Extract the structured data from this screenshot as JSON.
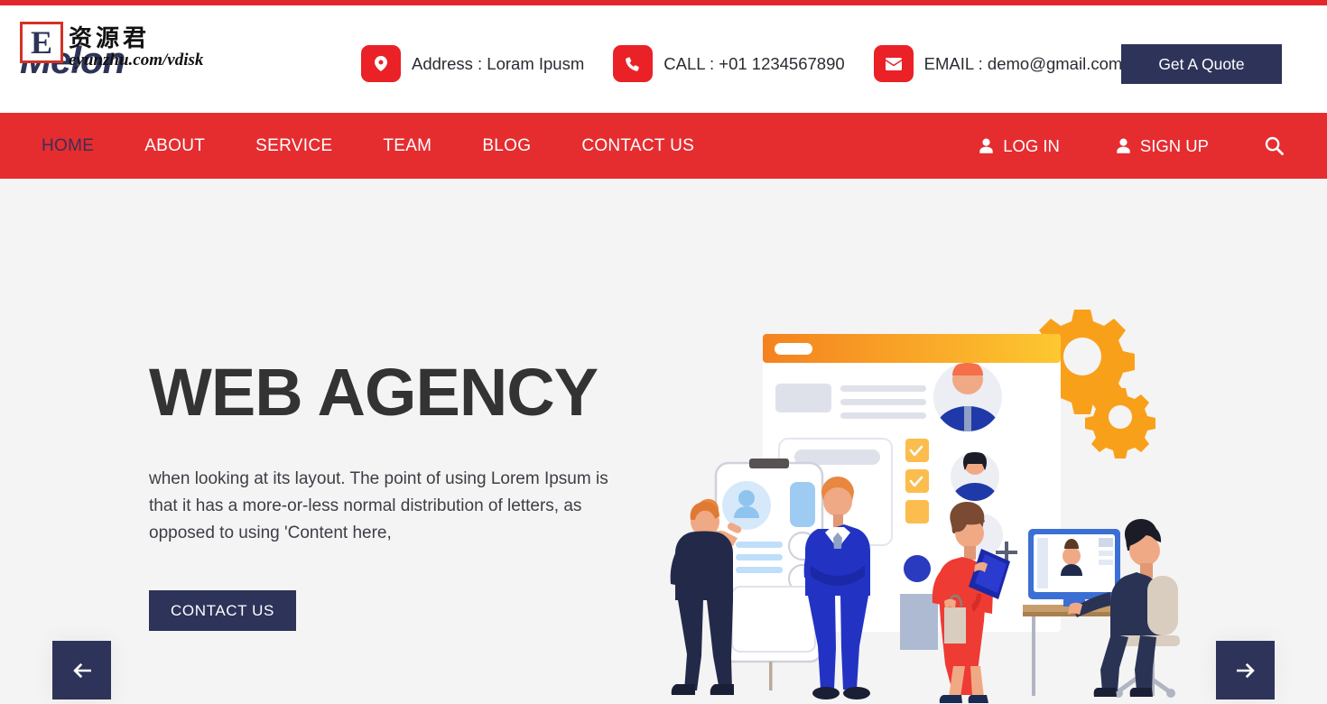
{
  "colors": {
    "primary_red": "#e52d30",
    "icon_red": "#ea2127",
    "navy": "#2e3359",
    "hero_bg": "#f4f4f4",
    "title_gray": "#333333",
    "accent_orange": "#f5a623",
    "accent_yellow": "#fdb913"
  },
  "topbar": {
    "logo_text": "Melon",
    "watermark": {
      "letter": "E",
      "chinese": "资源君",
      "url": "eyunzhu.com/vdisk"
    },
    "contacts": [
      {
        "icon": "location-pin-icon",
        "label": "Address : Loram Ipusm"
      },
      {
        "icon": "phone-icon",
        "label": "CALL : +01 1234567890"
      },
      {
        "icon": "envelope-icon",
        "label": "EMAIL : demo@gmail.com"
      }
    ],
    "quote_button": "Get A Quote"
  },
  "nav": {
    "items": [
      {
        "label": "HOME",
        "active": true
      },
      {
        "label": "ABOUT",
        "active": false
      },
      {
        "label": "SERVICE",
        "active": false
      },
      {
        "label": "TEAM",
        "active": false
      },
      {
        "label": "BLOG",
        "active": false
      },
      {
        "label": "CONTACT US",
        "active": false
      }
    ],
    "login_label": "LOG IN",
    "signup_label": "SIGN UP",
    "search_icon": "search-icon"
  },
  "hero": {
    "title": "WEB AGENCY",
    "paragraph": "when looking at its layout. The point of using Lorem Ipsum is that it has a more-or-less normal distribution of letters, as opposed to using 'Content here,",
    "cta_label": "CONTACT US",
    "prev_arrow": "arrow-left-icon",
    "next_arrow": "arrow-right-icon",
    "illustration": "business-team-web-design-illustration"
  }
}
